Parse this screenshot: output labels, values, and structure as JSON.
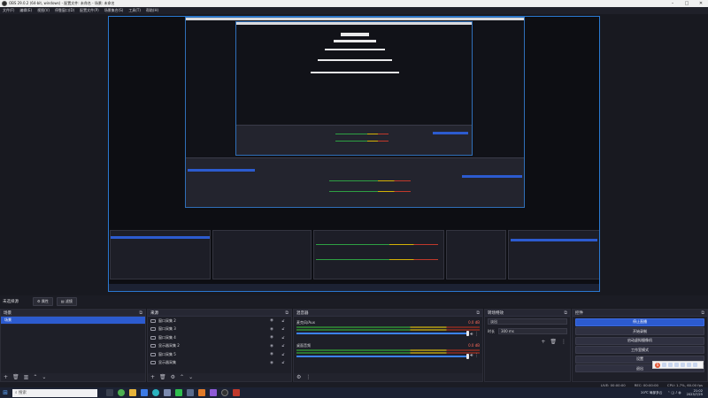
{
  "window": {
    "title": "OBS 29.0.2 (64-bit, windows) - 配置文件: 未命名 - 场景: 未命名"
  },
  "menu": [
    "文件(F)",
    "编辑(E)",
    "视图(V)",
    "停靠窗口(D)",
    "配置文件(P)",
    "场景集合(S)",
    "工具(T)",
    "帮助(H)"
  ],
  "scene_bar": {
    "label": "未选择源",
    "properties": "属性",
    "filters": "滤镜"
  },
  "docks": {
    "scenes": {
      "title": "场景",
      "items": [
        "场景"
      ]
    },
    "sources": {
      "title": "来源",
      "items": [
        "窗口采集 2",
        "窗口采集 3",
        "窗口采集 4",
        "显示器采集 2",
        "窗口采集 5",
        "显示器采集"
      ]
    },
    "mixer": {
      "title": "混音器",
      "tracks": [
        {
          "name": "麦克风/Aux",
          "db": "0.0 dB"
        },
        {
          "name": "桌面音频",
          "db": "0.0 dB"
        }
      ]
    },
    "transitions": {
      "title": "转场特效",
      "type_value": "淡出",
      "duration_label": "时长",
      "duration_value": "300 ms"
    },
    "controls": {
      "title": "控件",
      "buttons": [
        "停止直播",
        "开始录制",
        "启动虚拟摄像机",
        "工作室模式",
        "设置",
        "退出"
      ]
    }
  },
  "status": {
    "live": "LIVE: 00:00:00",
    "rec": "REC: 00:00:00",
    "cpu": "CPU: 1.7%, 60.00 fps"
  },
  "taskbar": {
    "search_placeholder": "搜索",
    "weather": "20℃",
    "weather_desc": "局部多云",
    "time": "21:02",
    "date": "2023/7/25"
  },
  "colors": {
    "accent": "#2c5bcf",
    "preview_border": "#2a78d0",
    "panel": "#1e1f28"
  },
  "icons": [
    "obs-app-icon",
    "minimize-icon",
    "maximize-icon",
    "close-icon",
    "gear-icon",
    "filter-icon",
    "add-icon",
    "remove-icon",
    "up-icon",
    "down-icon",
    "eye-icon",
    "lock-icon",
    "windows-start-icon",
    "search-icon"
  ]
}
